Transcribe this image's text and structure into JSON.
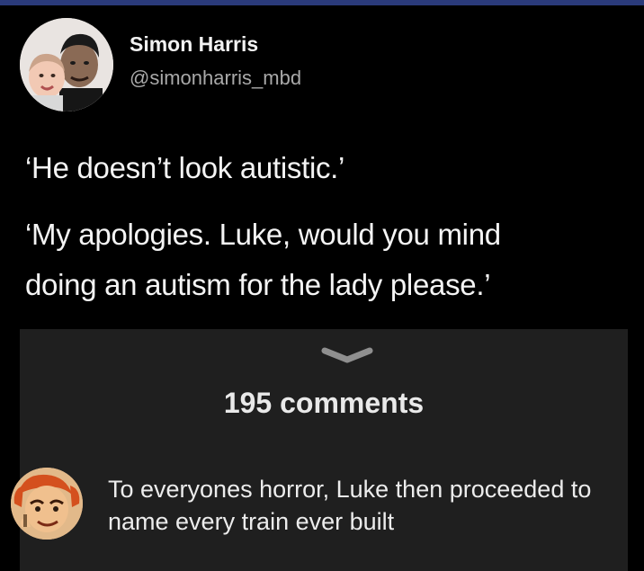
{
  "tweet": {
    "display_name": "Simon Harris",
    "handle": "@simonharris_mbd",
    "lines": [
      "‘He doesn’t look autistic.’",
      "‘My apologies. Luke, would you mind",
      "doing an autism for the lady please.’"
    ]
  },
  "comments_sheet": {
    "handle_icon": "chevron-down-icon",
    "count_label": "195 comments",
    "comments": [
      {
        "avatar_icon": "cartoon-avatar",
        "text": "To everyones horror, Luke then proceeded to name every train ever built"
      }
    ]
  },
  "colors": {
    "background": "#000000",
    "sheet_background": "#1f1f1f",
    "handle_text": "#a9a9a9",
    "top_frame": "#2a3a7a"
  }
}
